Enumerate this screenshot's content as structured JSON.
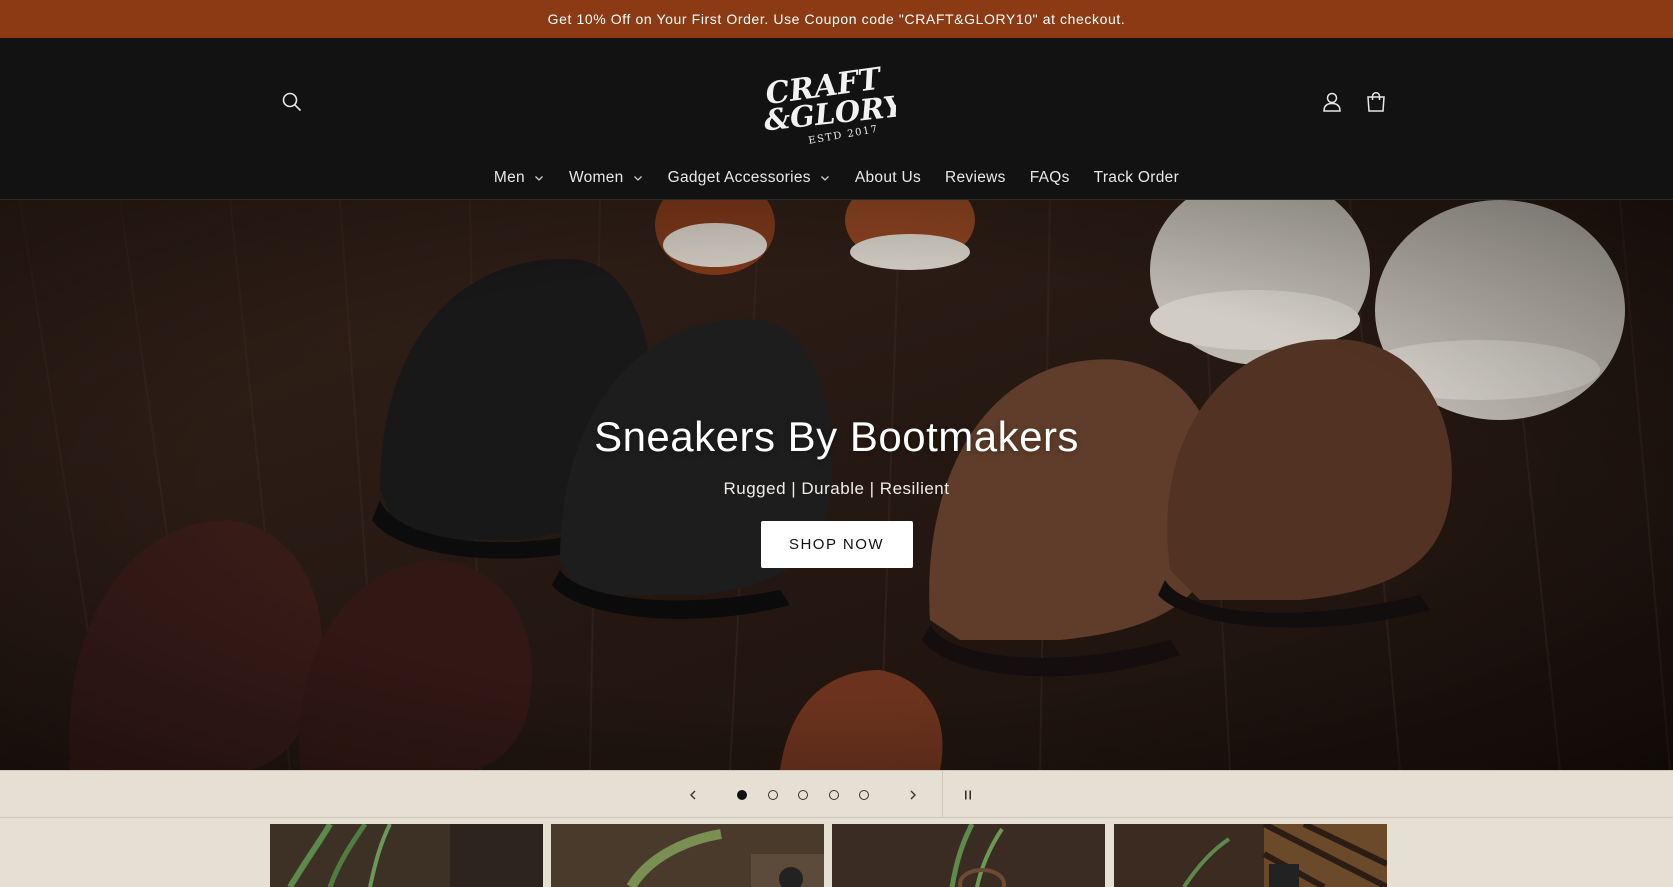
{
  "announcement": {
    "text": "Get 10% Off on Your First Order. Use Coupon code \"CRAFT&GLORY10\" at checkout."
  },
  "header": {
    "logo": {
      "line1": "CRAFT",
      "line2": "&GLORY",
      "line3": "ESTD 2017"
    },
    "icons": [
      "search-icon",
      "account-icon",
      "cart-icon"
    ]
  },
  "nav": {
    "items": [
      {
        "label": "Men",
        "dropdown": true
      },
      {
        "label": "Women",
        "dropdown": true
      },
      {
        "label": "Gadget Accessories",
        "dropdown": true
      },
      {
        "label": "About Us",
        "dropdown": false
      },
      {
        "label": "Reviews",
        "dropdown": false
      },
      {
        "label": "FAQs",
        "dropdown": false
      },
      {
        "label": "Track Order",
        "dropdown": false
      }
    ]
  },
  "hero": {
    "title": "Sneakers By Bootmakers",
    "subtitle": "Rugged | Durable | Resilient",
    "button": "SHOP NOW"
  },
  "slider": {
    "slide_count": 5,
    "active_index": 1
  },
  "colors": {
    "announcement_bg": "#8b3a14",
    "header_bg": "#121212",
    "controls_bg": "#e6e0d4"
  }
}
